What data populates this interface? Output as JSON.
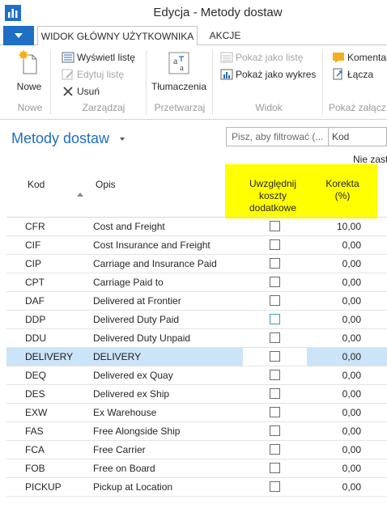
{
  "window": {
    "title": "Edycja - Metody dostaw"
  },
  "ribbon": {
    "tabs": [
      {
        "label": "WIDOK GŁÓWNY UŻYTKOWNIKA"
      },
      {
        "label": "AKCJE"
      }
    ],
    "groups": {
      "nowe": {
        "label": "Nowe",
        "new_label": "Nowe"
      },
      "zarzadzaj": {
        "label": "Zarządzaj",
        "view_list": "Wyświetl listę",
        "edit_list": "Edytuj listę",
        "delete": "Usuń"
      },
      "przetwarzaj": {
        "label": "Przetwarzaj",
        "translations": "Tłumaczenia"
      },
      "widok": {
        "label": "Widok",
        "show_as_list": "Pokaż jako listę",
        "show_as_chart": "Pokaż jako wykres"
      },
      "pokaz": {
        "label": "Pokaż załącz",
        "comments": "Komentar",
        "links": "Łącza"
      }
    }
  },
  "page": {
    "title": "Metody dostaw",
    "filter_placeholder": "Pisz, aby filtrować (...",
    "filter_field": "Kod",
    "filter_status": "Nie zast"
  },
  "grid": {
    "columns": {
      "kod": "Kod",
      "opis": "Opis",
      "uwzglednij": "Uwzględnij koszty dodatkowe",
      "korekta": "Korekta (%)"
    },
    "rows": [
      {
        "kod": "CFR",
        "opis": "Cost and Freight",
        "korekta": "10,00"
      },
      {
        "kod": "CIF",
        "opis": "Cost Insurance and Freight",
        "korekta": "0,00"
      },
      {
        "kod": "CIP",
        "opis": "Carriage and Insurance Paid",
        "korekta": "0,00"
      },
      {
        "kod": "CPT",
        "opis": "Carriage Paid to",
        "korekta": "0,00"
      },
      {
        "kod": "DAF",
        "opis": "Delivered at Frontier",
        "korekta": "0,00"
      },
      {
        "kod": "DDP",
        "opis": "Delivered Duty Paid",
        "korekta": "0,00"
      },
      {
        "kod": "DDU",
        "opis": "Delivered Duty Unpaid",
        "korekta": "0,00"
      },
      {
        "kod": "DELIVERY",
        "opis": "DELIVERY",
        "korekta": "0,00"
      },
      {
        "kod": "DEQ",
        "opis": "Delivered ex Quay",
        "korekta": "0,00"
      },
      {
        "kod": "DES",
        "opis": "Delivered ex Ship",
        "korekta": "0,00"
      },
      {
        "kod": "EXW",
        "opis": "Ex Warehouse",
        "korekta": "0,00"
      },
      {
        "kod": "FAS",
        "opis": "Free Alongside Ship",
        "korekta": "0,00"
      },
      {
        "kod": "FCA",
        "opis": "Free Carrier",
        "korekta": "0,00"
      },
      {
        "kod": "FOB",
        "opis": "Free on Board",
        "korekta": "0,00"
      },
      {
        "kod": "PICKUP",
        "opis": "Pickup at Location",
        "korekta": "0,00"
      }
    ]
  },
  "colors": {
    "accent": "#1f6fc5",
    "highlight": "#ffff00",
    "selected_row": "#cce4f7"
  }
}
